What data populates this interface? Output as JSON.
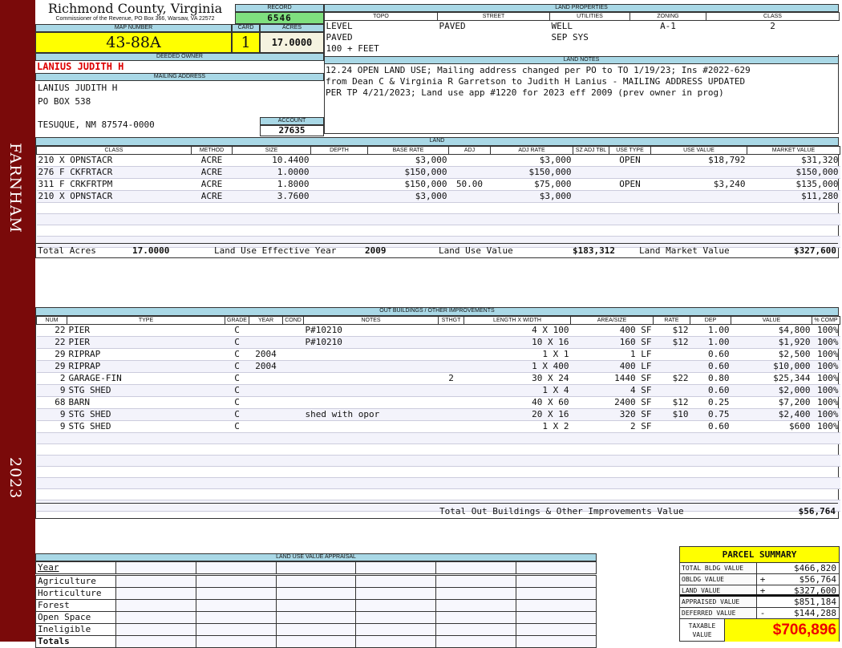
{
  "sidebar": {
    "district": "FARNHAM",
    "year": "2023"
  },
  "header": {
    "county": "Richmond County, Virginia",
    "subtitle": "Commissioner of the Revenue, PO Box 366, Warsaw, VA 22572"
  },
  "record": {
    "label": "RECORD",
    "value": "6546"
  },
  "map": {
    "label": "MAP NUMBER",
    "value": "43-88A"
  },
  "card": {
    "label": "CARD",
    "value": "1"
  },
  "acres": {
    "label": "ACRES",
    "value": "17.0000"
  },
  "owner": {
    "label": "DEEDED OWNER",
    "value": "LANIUS JUDITH H"
  },
  "mailing": {
    "label": "MAILING ADDRESS",
    "lines": [
      "LANIUS JUDITH H",
      "PO BOX 538",
      "TESUQUE, NM 87574-0000"
    ]
  },
  "account": {
    "label": "ACCOUNT",
    "value": "27635"
  },
  "land_properties": {
    "label": "LAND PROPERTIES",
    "columns": [
      "TOPO",
      "STREET",
      "UTILITIES",
      "ZONING",
      "CLASS"
    ],
    "rows": [
      [
        "LEVEL",
        "PAVED",
        "WELL",
        "A-1",
        "2"
      ],
      [
        "PAVED",
        "",
        "SEP SYS",
        "",
        ""
      ],
      [
        "100 + FEET",
        "",
        "",
        "",
        ""
      ]
    ]
  },
  "land_notes": {
    "label": "LAND NOTES",
    "lines": [
      "12.24 OPEN LAND USE; Mailing address changed per PO to TO 1/19/23; Ins #2022-629",
      "from Dean C & Virginia R Garretson to Judith H Lanius - MAILING ADDRESS UPDATED",
      "PER TP 4/21/2023; Land use app #1220 for 2023 eff 2009 (prev owner in prog)"
    ]
  },
  "land": {
    "label": "LAND",
    "columns": [
      "CLASS",
      "METHOD",
      "SIZE",
      "DEPTH",
      "BASE RATE",
      "ADJ",
      "ADJ RATE",
      "SZ ADJ TBL",
      "USE TYPE",
      "USE VALUE",
      "MARKET VALUE"
    ],
    "rows": [
      [
        "210 X OPNSTACR",
        "ACRE",
        "10.4400",
        "",
        "$3,000",
        "",
        "$3,000",
        "",
        "OPEN",
        "$18,792",
        "$31,320"
      ],
      [
        "276 F CKFRTACR",
        "ACRE",
        "1.0000",
        "",
        "$150,000",
        "",
        "$150,000",
        "",
        "",
        "",
        "$150,000"
      ],
      [
        "311 F CRKFRTPM",
        "ACRE",
        "1.8000",
        "",
        "$150,000",
        "50.00",
        "$75,000",
        "",
        "OPEN",
        "$3,240",
        "$135,000"
      ],
      [
        "210 X OPNSTACR",
        "ACRE",
        "3.7600",
        "",
        "$3,000",
        "",
        "$3,000",
        "",
        "",
        "",
        "$11,280"
      ]
    ],
    "totals": {
      "acres_label": "Total Acres",
      "acres": "17.0000",
      "year_label": "Land Use Effective Year",
      "year": "2009",
      "use_label": "Land Use Value",
      "use": "$183,312",
      "market_label": "Land Market Value",
      "market": "$327,600"
    }
  },
  "outbuildings": {
    "label": "OUT BUILDINGS / OTHER IMPROVEMENTS",
    "columns": [
      "NUM",
      "TYPE",
      "GRADE",
      "YEAR",
      "COND",
      "NOTES",
      "STHGT",
      "LENGTH X WIDTH",
      "AREA/SIZE",
      "RATE",
      "DEP",
      "VALUE",
      "% COMP"
    ],
    "rows": [
      [
        "22",
        "PIER",
        "C",
        "",
        "",
        "P#10210",
        "",
        "4 X 100",
        "400 SF",
        "$12",
        "1.00",
        "$4,800",
        "100%"
      ],
      [
        "22",
        "PIER",
        "C",
        "",
        "",
        "P#10210",
        "",
        "10 X 16",
        "160 SF",
        "$12",
        "1.00",
        "$1,920",
        "100%"
      ],
      [
        "29",
        "RIPRAP",
        "C",
        "2004",
        "",
        "",
        "",
        "1 X 1",
        "1 LF",
        "",
        "0.60",
        "$2,500",
        "100%"
      ],
      [
        "29",
        "RIPRAP",
        "C",
        "2004",
        "",
        "",
        "",
        "1 X 400",
        "400 LF",
        "",
        "0.60",
        "$10,000",
        "100%"
      ],
      [
        "2",
        "GARAGE-FIN",
        "C",
        "",
        "",
        "",
        "2",
        "30 X 24",
        "1440 SF",
        "$22",
        "0.80",
        "$25,344",
        "100%"
      ],
      [
        "9",
        "STG SHED",
        "C",
        "",
        "",
        "",
        "",
        "1 X 4",
        "4 SF",
        "",
        "0.60",
        "$2,000",
        "100%"
      ],
      [
        "68",
        "BARN",
        "C",
        "",
        "",
        "",
        "",
        "40 X 60",
        "2400 SF",
        "$12",
        "0.25",
        "$7,200",
        "100%"
      ],
      [
        "9",
        "STG SHED",
        "C",
        "",
        "",
        "shed with opor",
        "",
        "20 X 16",
        "320 SF",
        "$10",
        "0.75",
        "$2,400",
        "100%"
      ],
      [
        "9",
        "STG SHED",
        "C",
        "",
        "",
        "",
        "",
        "1 X 2",
        "2 SF",
        "",
        "0.60",
        "$600",
        "100%"
      ]
    ],
    "total_label": "Total Out Buildings & Other Improvements Value",
    "total": "$56,764"
  },
  "land_use_appraisal": {
    "label": "LAND USE VALUE APPRAISAL",
    "rows": [
      "Year",
      "Agriculture",
      "Horticulture",
      "Forest",
      "Open Space",
      "Ineligible",
      "Totals"
    ]
  },
  "parcel_summary": {
    "title": "PARCEL SUMMARY",
    "rows": [
      {
        "label": "TOTAL BLDG VALUE",
        "sign": "",
        "value": "$466,820"
      },
      {
        "label": "OBLDG VALUE",
        "sign": "+",
        "value": "$56,764"
      },
      {
        "label": "LAND VALUE",
        "sign": "+",
        "value": "$327,600"
      },
      {
        "label": "APPRAISED VALUE",
        "sign": "",
        "value": "$851,184"
      },
      {
        "label": "DEFERRED VALUE",
        "sign": "-",
        "value": "$144,288"
      }
    ],
    "taxable_label": "TAXABLE VALUE",
    "taxable": "$706,896"
  },
  "colors": {
    "sidebar": "#7a0a0a",
    "header": "#a9d8e6",
    "yellow": "#ffff00",
    "record_green": "#7fe07f",
    "owner_red": "#dd0000"
  }
}
